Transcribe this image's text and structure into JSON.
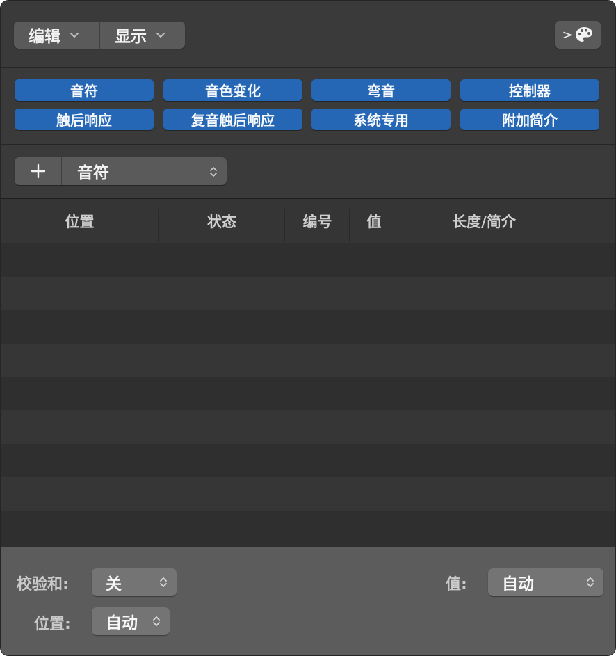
{
  "toolbar": {
    "edit_label": "编辑",
    "view_label": "显示",
    "midi_button_icon": "midi-palette-icon",
    "midi_button_prefix": ">"
  },
  "filters": [
    {
      "label": "音符"
    },
    {
      "label": "音色变化"
    },
    {
      "label": "弯音"
    },
    {
      "label": "控制器"
    },
    {
      "label": "触后响应"
    },
    {
      "label": "复音触后响应"
    },
    {
      "label": "系统专用"
    },
    {
      "label": "附加简介"
    }
  ],
  "add_row": {
    "plus_icon": "plus-icon",
    "type_value": "音符"
  },
  "table": {
    "columns": [
      "位置",
      "状态",
      "编号",
      "值",
      "长度/简介"
    ]
  },
  "settings": {
    "checksum_label": "校验和:",
    "checksum_value": "关",
    "position_label": "位置:",
    "position_value": "自动",
    "value_label": "值:",
    "value_value": "自动"
  },
  "colors": {
    "filter_button": "#2667b5",
    "window_bg": "#3a3a3a",
    "bottom_panel": "#5c5c5c"
  }
}
